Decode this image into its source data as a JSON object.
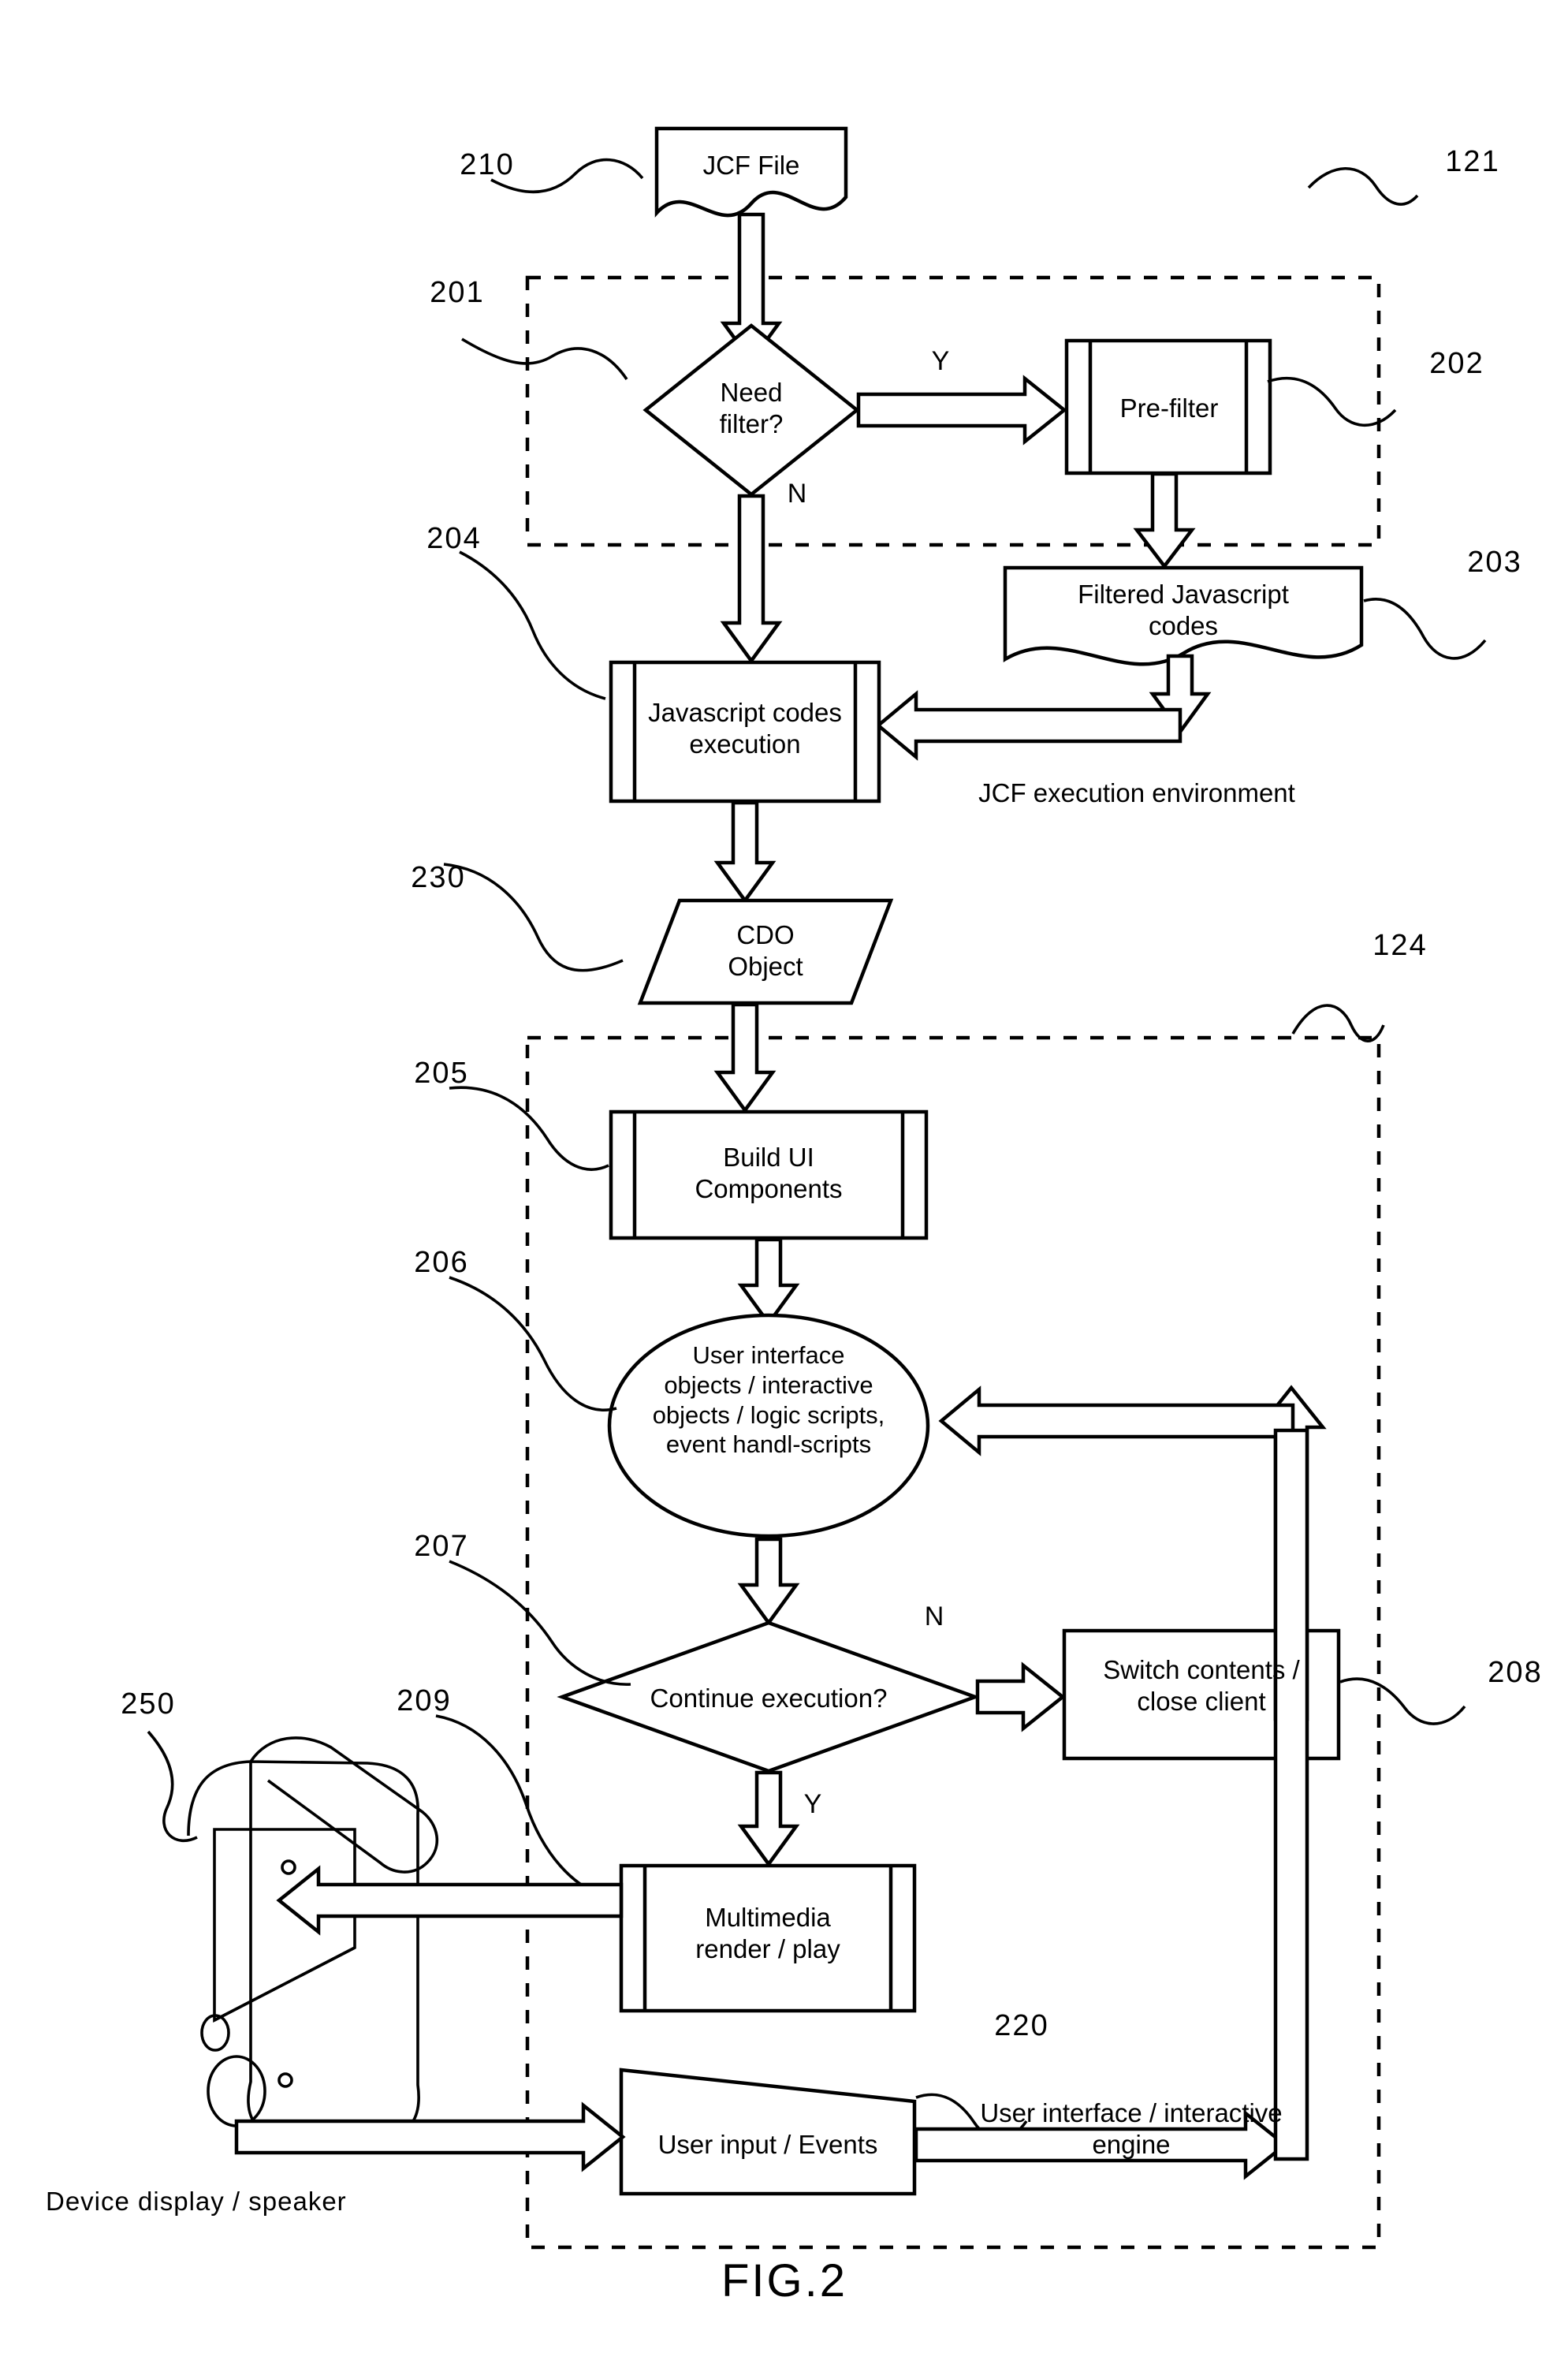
{
  "figure": {
    "caption": "FIG.2",
    "reference_numbers": {
      "jcf_file": "210",
      "need_filter": "201",
      "pre_filter": "202",
      "filtered_js_codes": "203",
      "js_codes_execution": "204",
      "cdo_object": "230",
      "build_ui_components": "205",
      "ui_objects_ellipse": "206",
      "continue_execution": "207",
      "switch_contents": "208",
      "multimedia_render": "209",
      "user_input_events": "220",
      "device": "250",
      "jcf_zone": "121",
      "ui_zone": "124"
    },
    "zones": [
      {
        "id": "jcf-zone",
        "label": "JCF execution environment",
        "ref": "121"
      },
      {
        "id": "ui-zone",
        "label": "User interface / interactive\nengine",
        "ref": "124"
      }
    ],
    "nodes": [
      {
        "id": "jcf-file",
        "shape": "document",
        "label": "JCF File",
        "ref": "210"
      },
      {
        "id": "need-filter",
        "shape": "decision",
        "label": "Need\nfilter?",
        "ref": "201"
      },
      {
        "id": "pre-filter",
        "shape": "process",
        "label": "Pre-filter",
        "ref": "202"
      },
      {
        "id": "filtered-js",
        "shape": "document",
        "label": "Filtered Javascript\ncodes",
        "ref": "203"
      },
      {
        "id": "js-exec",
        "shape": "process",
        "label": "Javascript codes\nexecution",
        "ref": "204"
      },
      {
        "id": "cdo-object",
        "shape": "parallelogram",
        "label": "CDO\nObject",
        "ref": "230"
      },
      {
        "id": "build-ui",
        "shape": "process",
        "label": "Build UI\nComponents",
        "ref": "205"
      },
      {
        "id": "ui-objects",
        "shape": "ellipse",
        "label": "User interface\nobjects / interactive\nobjects / logic scripts,\nevent handl-scripts",
        "ref": "206"
      },
      {
        "id": "continue-exec",
        "shape": "decision",
        "label": "Continue execution?",
        "ref": "207"
      },
      {
        "id": "switch-close",
        "shape": "rectangle",
        "label": "Switch contents /\nclose client",
        "ref": "208"
      },
      {
        "id": "multimedia",
        "shape": "process",
        "label": "Multimedia\nrender / play",
        "ref": "209"
      },
      {
        "id": "user-input",
        "shape": "trapezoid",
        "label": "User input / Events",
        "ref": "220"
      }
    ],
    "branch_labels": {
      "need_filter_yes": "Y",
      "need_filter_no": "N",
      "continue_exec_no": "N",
      "continue_exec_yes": "Y"
    },
    "device_caption": "Device display / speaker"
  }
}
